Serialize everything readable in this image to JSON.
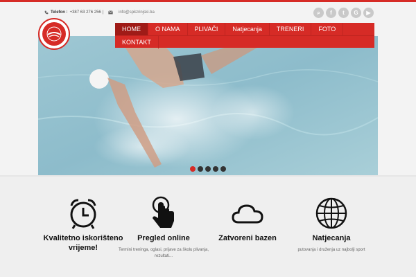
{
  "topbar": {
    "phone_label": "Telefon :",
    "phone": "+387 63 276 256 |",
    "email": "info@spkzrinjski.ba",
    "social": [
      {
        "icon": "search-icon",
        "glyph": "⌕"
      },
      {
        "icon": "facebook-icon",
        "glyph": "f"
      },
      {
        "icon": "twitter-icon",
        "glyph": "t"
      },
      {
        "icon": "google-plus-icon",
        "glyph": "G"
      },
      {
        "icon": "youtube-icon",
        "glyph": "▶"
      }
    ]
  },
  "nav": {
    "items": [
      "HOME",
      "O NAMA",
      "PLIVAČI",
      "Natjecanja",
      "TRENERI",
      "FOTO"
    ],
    "items_row2": [
      "KONTAKT"
    ],
    "active_index": 0
  },
  "slider": {
    "dot_count": 5,
    "active_index": 0
  },
  "features": [
    {
      "icon": "alarm-clock-icon",
      "title": "Kvalitetno iskorišteno vrijeme!",
      "text": ""
    },
    {
      "icon": "touch-hand-icon",
      "title": "Pregled online",
      "text": "Termini treninga, oglasi, prijave za školu plivanja, rezultati..."
    },
    {
      "icon": "cloud-icon",
      "title": "Zatvoreni bazen",
      "text": ""
    },
    {
      "icon": "globe-icon",
      "title": "Natjecanja",
      "text": "putovanja i druženja uz najbolji sport"
    }
  ],
  "colors": {
    "accent": "#d62b26",
    "accent_dark": "#9f1b17"
  }
}
